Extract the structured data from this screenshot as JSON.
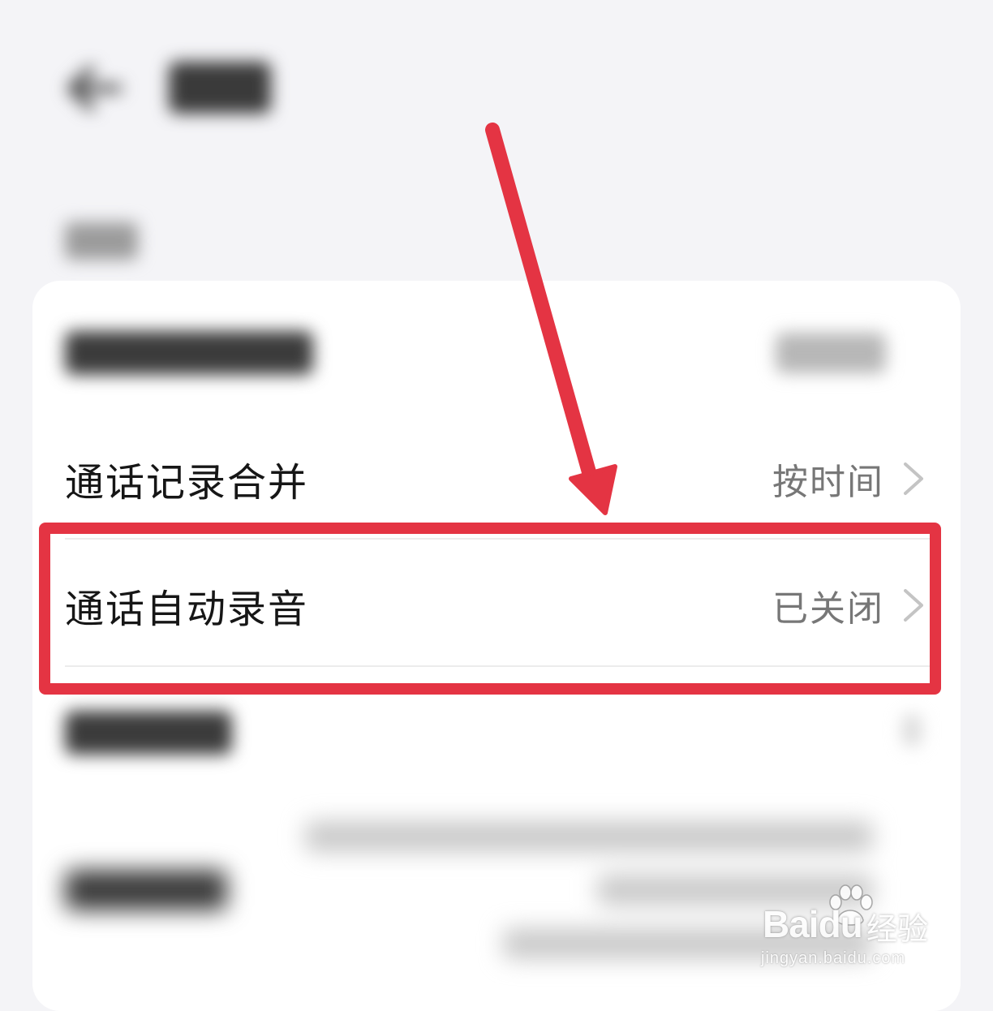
{
  "rows": [
    {
      "label": "通话记录合并",
      "value": "按时间"
    },
    {
      "label": "通话自动录音",
      "value": "已关闭"
    }
  ],
  "watermark": {
    "brand": "Baidu",
    "suffix": "经验",
    "url": "jingyan.baidu.com"
  },
  "colors": {
    "highlight": "#e43443",
    "background": "#f4f4f7",
    "card": "#ffffff",
    "value_text": "#777777"
  },
  "icons": [
    "back-arrow-icon",
    "chevron-right-icon",
    "annotation-arrow-icon",
    "baidu-paw-icon"
  ]
}
